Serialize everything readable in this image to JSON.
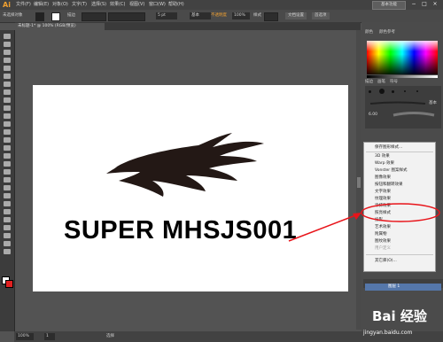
{
  "app": {
    "logo": "Ai"
  },
  "menubar": {
    "items": [
      "文件(F)",
      "编辑(E)",
      "对象(O)",
      "文字(T)",
      "选择(S)",
      "效果(C)",
      "视图(V)",
      "窗口(W)",
      "帮助(H)"
    ],
    "workspace_label": "基本功能",
    "window_controls": [
      "−",
      "□",
      "×"
    ]
  },
  "controlbar": {
    "selection_label": "未选择对象",
    "stroke_label": "描边",
    "stroke_size": "5 pt",
    "stroke_style": "基本",
    "opacity_label": "不透明度",
    "opacity_value": "100%",
    "style_label": "样式",
    "doc_setup": "文档设置",
    "prefs": "首选项"
  },
  "document": {
    "tab_title": "未标题-1* @ 100% (RGB/预览)"
  },
  "canvas": {
    "art_text": "SUPER MHSJS001"
  },
  "statusbar": {
    "zoom": "100%",
    "page": "1",
    "tool": "选择"
  },
  "panels": {
    "color_tabs": [
      "颜色",
      "颜色参考"
    ],
    "brush_tabs": [
      "描边",
      "画笔",
      "符号"
    ],
    "brush_name": "基本",
    "brush_size": "6.00",
    "effect_menu": [
      {
        "label": "保存图形样式...",
        "disabled": false
      },
      {
        "label": "3D 效果",
        "disabled": false
      },
      {
        "label": "Warp 效果",
        "disabled": false
      },
      {
        "label": "Vonster 图案样式",
        "disabled": false
      },
      {
        "label": "图像效果",
        "disabled": false
      },
      {
        "label": "按钮和翻转效果",
        "disabled": false
      },
      {
        "label": "文字效果",
        "disabled": false
      },
      {
        "label": "纹理效果",
        "disabled": false
      },
      {
        "label": "涂抹效果",
        "disabled": false
      },
      {
        "label": "照亮样式",
        "disabled": false
      },
      {
        "label": "投影",
        "disabled": false
      },
      {
        "label": "艺术效果",
        "disabled": false
      },
      {
        "label": "附属物",
        "disabled": false
      },
      {
        "label": "图纹效果",
        "disabled": false
      },
      {
        "label": "用户定义",
        "disabled": true
      },
      {
        "label": "其它库(O)...",
        "disabled": false
      }
    ],
    "layers_label": "图层 1"
  },
  "watermark": {
    "brand": "Bai 经验",
    "url": "jingyan.baidu.com"
  },
  "colors": {
    "annotation": "#e8141a",
    "artwork": "#231815"
  }
}
